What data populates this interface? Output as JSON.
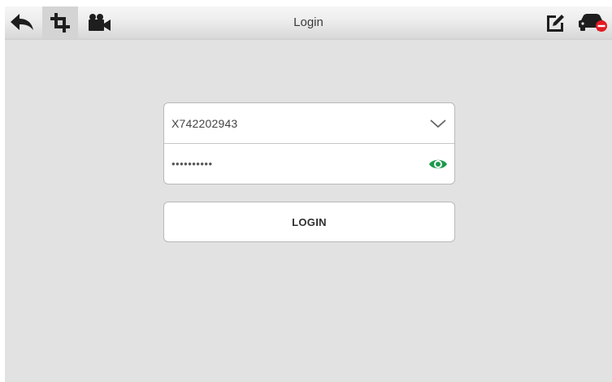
{
  "toolbar": {
    "title": "Login",
    "icons": [
      "back-arrow-icon",
      "crop-icon",
      "video-camera-icon",
      "edit-icon",
      "vehicle-disconnected-icon"
    ],
    "bar_color": "#e9e9e9",
    "icon_color": "#1e1e1e",
    "alert_color": "#e31b23"
  },
  "login_form": {
    "username": {
      "value": "X742202943",
      "icon": "chevron-down-icon"
    },
    "password": {
      "masked_value": "••••••••••",
      "icon": "eye-icon",
      "icon_color": "#1a9b4c"
    },
    "login_button_label": "LOGIN"
  },
  "colors": {
    "background": "#e2e2e2",
    "field_background": "#ffffff",
    "border": "#b9b9b9"
  }
}
